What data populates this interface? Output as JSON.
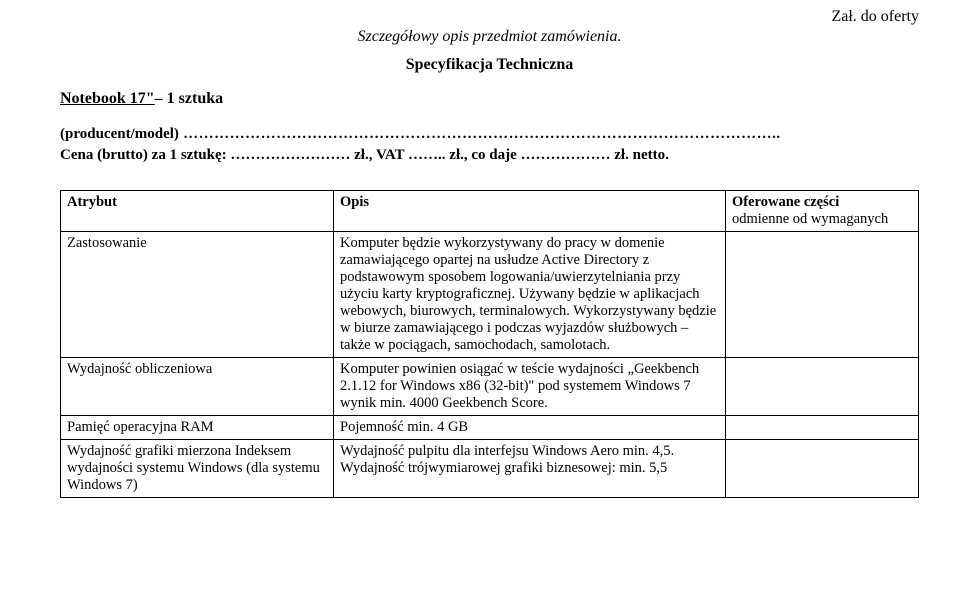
{
  "annex": "Zał. do oferty",
  "title_italic": "Szczegółowy opis przedmiot zamówienia.",
  "title_bold": "Specyfikacja Techniczna",
  "notebook_underline": "Notebook 17\"",
  "notebook_rest": " – 1 sztuka",
  "producer_label": "(producent/model)",
  "producer_dots": " ……………………………………………………………………………………………………..",
  "price_line1": "Cena (brutto) za 1 sztukę: …………………… zł., VAT …….. zł., co daje ……………… zł. netto.",
  "table": {
    "header": {
      "c1": "Atrybut",
      "c2": "Opis",
      "c3a": "Oferowane części",
      "c3b": "odmienne od wymaganych"
    },
    "rows": [
      {
        "attr": "Zastosowanie",
        "desc": "Komputer będzie wykorzystywany do pracy w domenie zamawiającego opartej na usłudze Active Directory z podstawowym sposobem logowania/uwierzytelniania przy użyciu karty kryptograficznej. Używany będzie w aplikacjach webowych, biurowych, terminalowych. Wykorzystywany będzie w biurze zamawiającego i podczas wyjazdów służbowych – także w pociągach, samochodach, samolotach."
      },
      {
        "attr": "Wydajność obliczeniowa",
        "desc": "Komputer powinien osiągać w teście wydajności „Geekbench 2.1.12 for Windows x86 (32-bit)\" pod systemem Windows 7 wynik min. 4000 Geekbench Score."
      },
      {
        "attr": "Pamięć operacyjna RAM",
        "desc": "Pojemność min. 4 GB"
      },
      {
        "attr": "Wydajność grafiki mierzona Indeksem wydajności systemu Windows (dla systemu Windows 7)",
        "desc": "Wydajność pulpitu dla interfejsu Windows Aero min. 4,5. Wydajność trójwymiarowej grafiki biznesowej: min. 5,5"
      }
    ]
  }
}
